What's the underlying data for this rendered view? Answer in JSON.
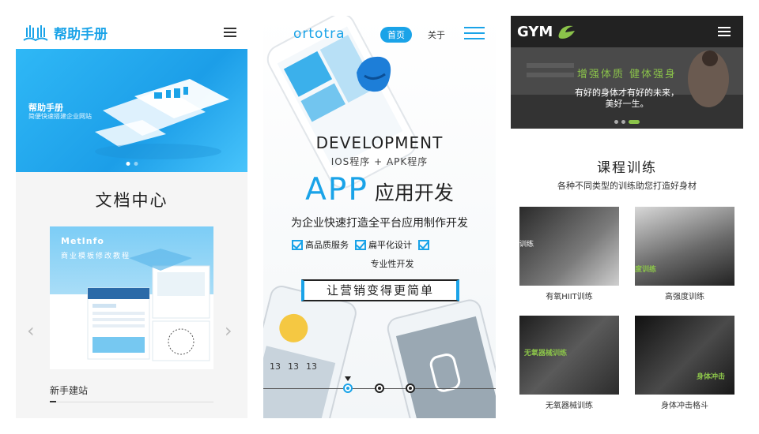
{
  "panel1": {
    "logo_text": "帮助手册",
    "banner": {
      "title": "帮助手册",
      "subtitle": "简便快速搭建企业网站"
    },
    "section_title": "文档中心",
    "card": {
      "title": "MetInfo",
      "subtitle": "商业模板修改教程"
    },
    "prev_arrow": "‹",
    "next_arrow": "›",
    "footer_label": "新手建站"
  },
  "panel2": {
    "brand": "ortotra",
    "nav": {
      "home": "首页",
      "about": "关于"
    },
    "heading": "DEVELOPMENT",
    "subheading": "IOS程序 + APK程序",
    "app_word": "APP",
    "app_suffix": "应用开发",
    "tagline": "为企业快速打造全平台应用制作开发",
    "features": [
      "高品质服务",
      "扁平化设计",
      "专业性开发"
    ],
    "slogan_button": "让营销变得更简单",
    "phone_text": [
      "13",
      "13",
      "13"
    ]
  },
  "panel3": {
    "logo_text": "GYM",
    "hero": {
      "headline": "增强体质  健体强身",
      "line1": "有好的身体才有好的未来，",
      "line2": "美好一生。"
    },
    "section_title": "课程训练",
    "section_subtitle": "各种不同类型的训练助您打造好身材",
    "courses": [
      {
        "caption": "有氧HIIT训练",
        "overlay": "训练"
      },
      {
        "caption": "高强度训练",
        "overlay": "度训练"
      },
      {
        "caption": "无氧器械训练",
        "overlay": "无氧器械训练"
      },
      {
        "caption": "身体冲击格斗",
        "overlay": "身体冲击"
      }
    ]
  },
  "colors": {
    "blue_accent": "#1aa3e8",
    "gym_green": "#8bc34a",
    "dark_header": "#222222"
  }
}
